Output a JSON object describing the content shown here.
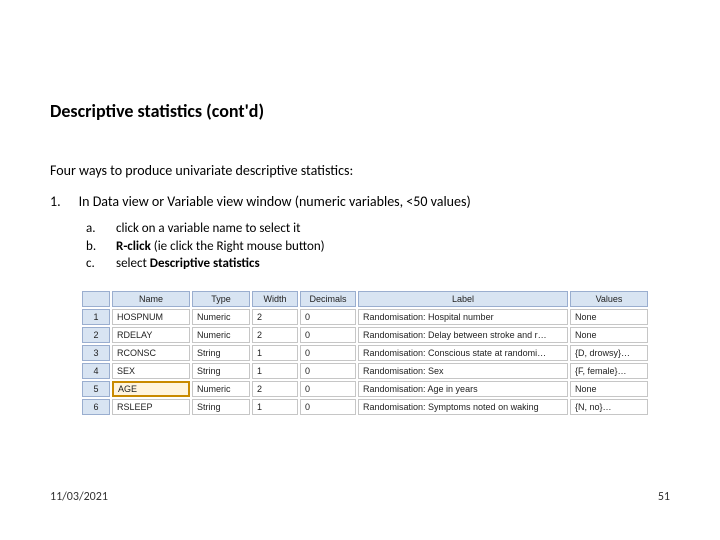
{
  "title": "Descriptive statistics (cont'd)",
  "intro": "Four ways to produce univariate descriptive statistics:",
  "item": {
    "num": "1.",
    "text": "In Data view or Variable view window (numeric variables, <50 values)"
  },
  "sub": {
    "a": {
      "lab": "a.",
      "txt": "click on a variable name to select it"
    },
    "b": {
      "lab": "b.",
      "pre": "",
      "bold": "R-click",
      "post": " (ie click the Right mouse button)"
    },
    "c": {
      "lab": "c.",
      "pre": "select ",
      "bold": "Descriptive statistics",
      "post": ""
    }
  },
  "table": {
    "headers": {
      "blank": "",
      "name": "Name",
      "type": "Type",
      "width": "Width",
      "decimals": "Decimals",
      "label": "Label",
      "values": "Values"
    },
    "rows": [
      {
        "n": "1",
        "name": "HOSPNUM",
        "type": "Numeric",
        "width": "2",
        "dec": "0",
        "label": "Randomisation: Hospital number",
        "values": "None"
      },
      {
        "n": "2",
        "name": "RDELAY",
        "type": "Numeric",
        "width": "2",
        "dec": "0",
        "label": "Randomisation: Delay between stroke and r…",
        "values": "None"
      },
      {
        "n": "3",
        "name": "RCONSC",
        "type": "String",
        "width": "1",
        "dec": "0",
        "label": "Randomisation: Conscious state at randomi…",
        "values": "{D, drowsy}…"
      },
      {
        "n": "4",
        "name": "SEX",
        "type": "String",
        "width": "1",
        "dec": "0",
        "label": "Randomisation: Sex",
        "values": "{F, female}…"
      },
      {
        "n": "5",
        "name": "AGE",
        "type": "Numeric",
        "width": "2",
        "dec": "0",
        "label": "Randomisation: Age in years",
        "values": "None",
        "selected": true
      },
      {
        "n": "6",
        "name": "RSLEEP",
        "type": "String",
        "width": "1",
        "dec": "0",
        "label": "Randomisation: Symptoms noted on waking",
        "values": "{N, no}…"
      }
    ]
  },
  "footer": {
    "date": "11/03/2021",
    "page": "51"
  }
}
